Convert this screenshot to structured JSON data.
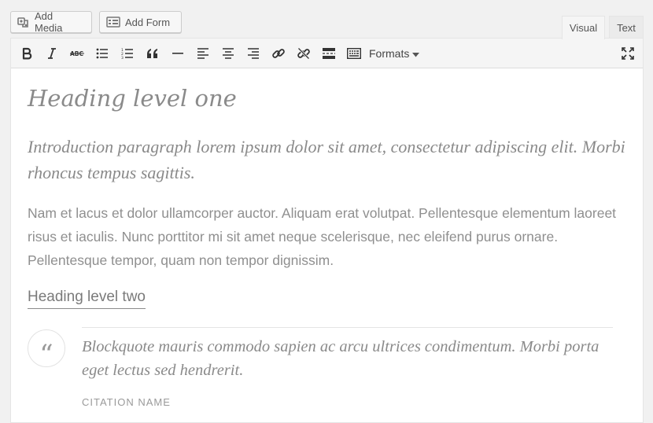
{
  "media_buttons": {
    "add_media": "Add Media",
    "add_form": "Add Form"
  },
  "tabs": {
    "visual": "Visual",
    "text": "Text",
    "active": "visual"
  },
  "toolbar": {
    "buttons": [
      {
        "name": "bold",
        "icon": "bold-icon"
      },
      {
        "name": "italic",
        "icon": "italic-icon"
      },
      {
        "name": "strikethrough",
        "icon": "strikethrough-icon",
        "label": "ABC"
      },
      {
        "name": "bulleted-list",
        "icon": "bulleted-list-icon"
      },
      {
        "name": "numbered-list",
        "icon": "numbered-list-icon"
      },
      {
        "name": "blockquote",
        "icon": "blockquote-icon"
      },
      {
        "name": "horizontal-line",
        "icon": "horizontal-line-icon"
      },
      {
        "name": "align-left",
        "icon": "align-left-icon"
      },
      {
        "name": "align-center",
        "icon": "align-center-icon"
      },
      {
        "name": "align-right",
        "icon": "align-right-icon"
      },
      {
        "name": "insert-link",
        "icon": "link-icon"
      },
      {
        "name": "remove-link",
        "icon": "unlink-icon"
      },
      {
        "name": "read-more",
        "icon": "read-more-icon"
      },
      {
        "name": "toolbar-toggle",
        "icon": "keyboard-icon"
      }
    ],
    "formats_label": "Formats",
    "fullscreen_icon": "fullscreen-icon"
  },
  "content": {
    "heading_one": "Heading level one",
    "intro": "Introduction paragraph lorem ipsum dolor sit amet, consectetur adipiscing elit. Morbi rhoncus tempus sagittis.",
    "paragraph": "Nam et lacus et dolor ullamcorper auctor. Aliquam erat volutpat. Pellentesque elementum laoreet risus et iaculis. Nunc porttitor mi sit amet neque scelerisque, nec eleifend purus ornare. Pellentesque tempor, quam non tempor dignissim.",
    "heading_two": "Heading level two",
    "blockquote": "Blockquote mauris commodo sapien ac arcu ultrices condimentum. Morbi porta eget lectus sed hendrerit.",
    "citation": "CITATION NAME",
    "quote_glyph": "“"
  },
  "colors": {
    "toolbar_bg": "#f5f5f5",
    "editor_bg": "#ffffff",
    "text_gray": "#8a8a8a",
    "icon_gray": "#555555"
  }
}
